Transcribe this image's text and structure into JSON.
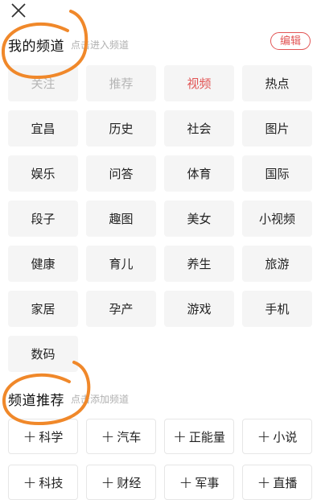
{
  "my_channels": {
    "title": "我的频道",
    "hint": "点击进入频道",
    "edit_label": "编辑",
    "items": [
      {
        "label": "关注",
        "state": "disabled"
      },
      {
        "label": "推荐",
        "state": "disabled"
      },
      {
        "label": "视频",
        "state": "active"
      },
      {
        "label": "热点",
        "state": "normal"
      },
      {
        "label": "宜昌",
        "state": "normal"
      },
      {
        "label": "历史",
        "state": "normal"
      },
      {
        "label": "社会",
        "state": "normal"
      },
      {
        "label": "图片",
        "state": "normal"
      },
      {
        "label": "娱乐",
        "state": "normal"
      },
      {
        "label": "问答",
        "state": "normal"
      },
      {
        "label": "体育",
        "state": "normal"
      },
      {
        "label": "国际",
        "state": "normal"
      },
      {
        "label": "段子",
        "state": "normal"
      },
      {
        "label": "趣图",
        "state": "normal"
      },
      {
        "label": "美女",
        "state": "normal"
      },
      {
        "label": "小视频",
        "state": "normal"
      },
      {
        "label": "健康",
        "state": "normal"
      },
      {
        "label": "育儿",
        "state": "normal"
      },
      {
        "label": "养生",
        "state": "normal"
      },
      {
        "label": "旅游",
        "state": "normal"
      },
      {
        "label": "家居",
        "state": "normal"
      },
      {
        "label": "孕产",
        "state": "normal"
      },
      {
        "label": "游戏",
        "state": "normal"
      },
      {
        "label": "手机",
        "state": "normal"
      },
      {
        "label": "数码",
        "state": "normal"
      }
    ]
  },
  "recommended_channels": {
    "title": "频道推荐",
    "hint": "点击添加频道",
    "plus_symbol": "+",
    "items": [
      "科学",
      "汽车",
      "正能量",
      "小说",
      "科技",
      "财经",
      "军事",
      "直播"
    ]
  },
  "icons": {
    "close": "close-icon",
    "add": "plus-icon"
  },
  "colors": {
    "accent": "#e25555",
    "chip_bg": "#f5f5f5",
    "disabled_text": "#b5b5b5",
    "annotation": "#f0882a"
  }
}
